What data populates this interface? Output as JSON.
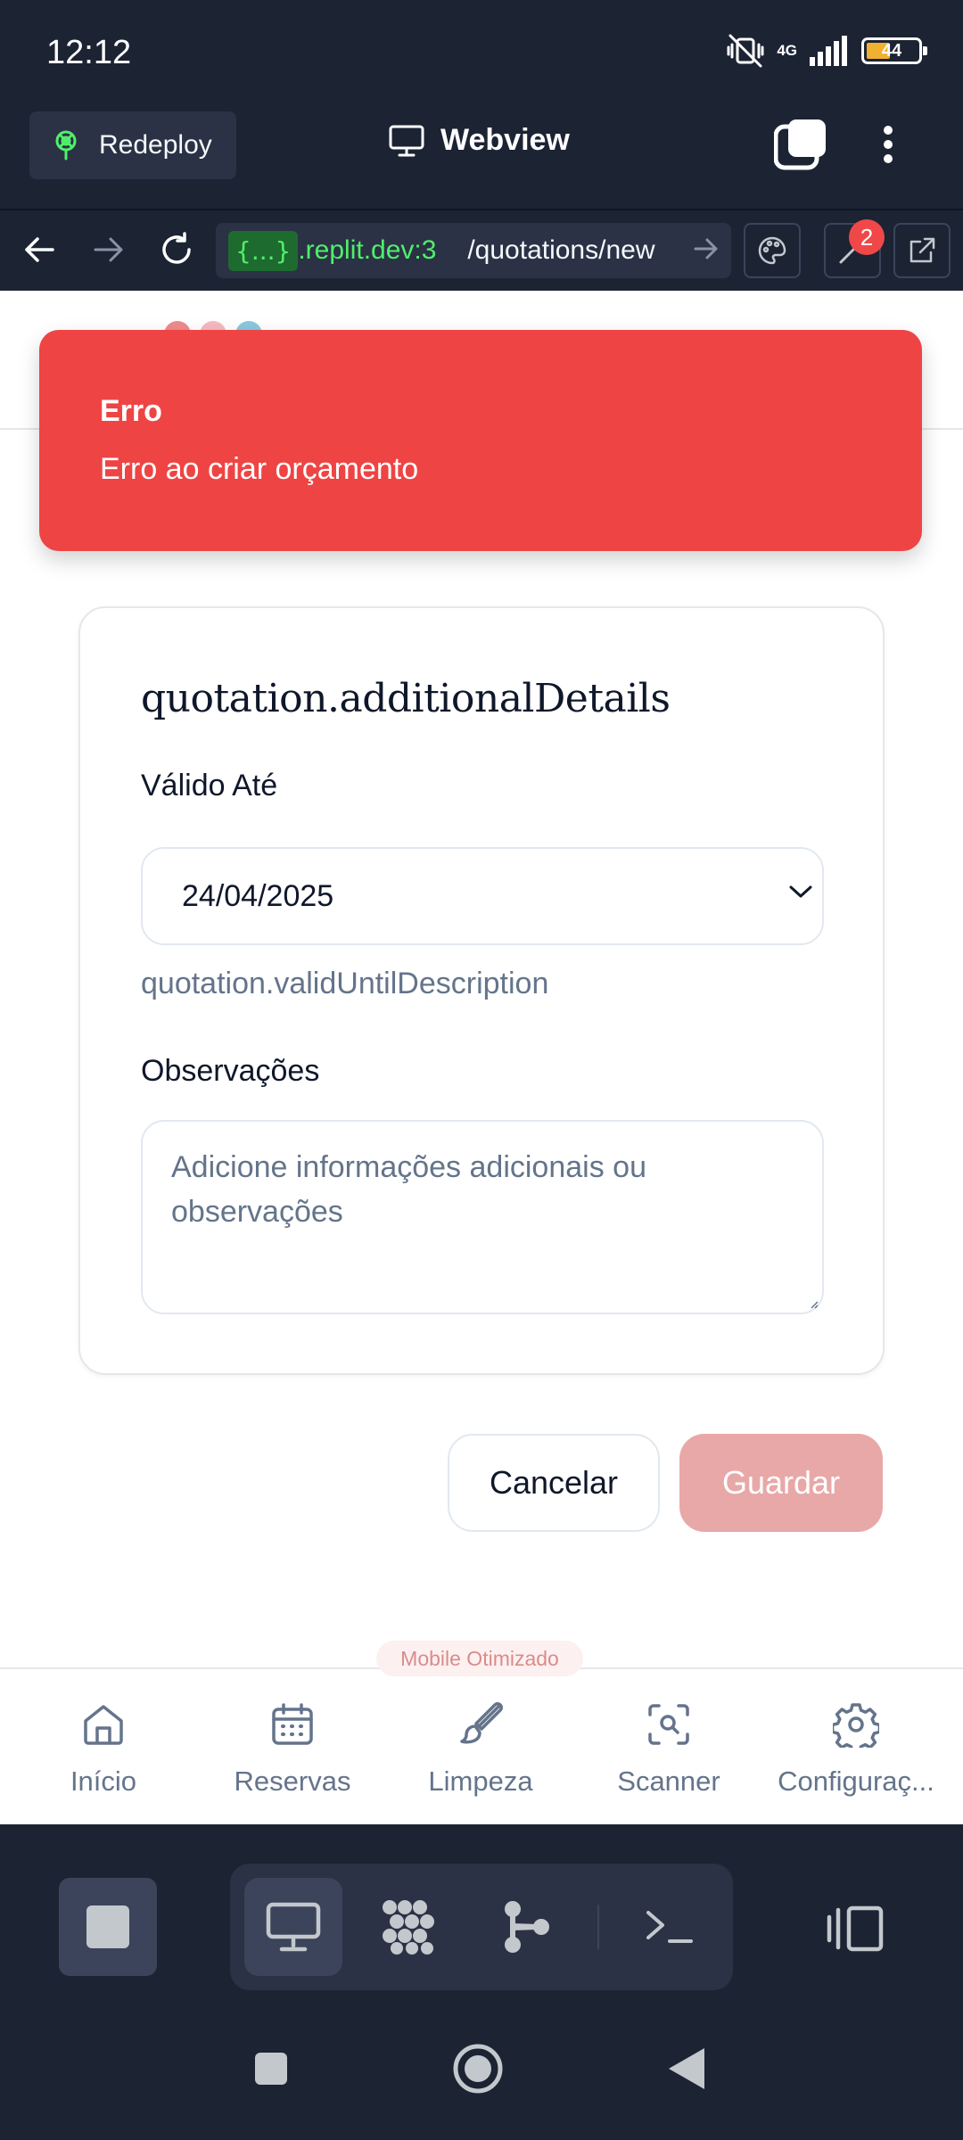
{
  "status_bar": {
    "time": "12:12",
    "network": "4G",
    "battery": "44"
  },
  "replit": {
    "redeploy_label": "Redeploy",
    "title": "Webview"
  },
  "url_bar": {
    "tag": "{...}",
    "host": ".replit.dev:3",
    "path": "/quotations/new",
    "tools_badge": "2"
  },
  "toast": {
    "title": "Erro",
    "message": "Erro ao criar orçamento"
  },
  "form": {
    "title": "quotation.additionalDetails",
    "valid_until_label": "Válido Até",
    "valid_until_value": "24/04/2025",
    "valid_until_help": "quotation.validUntilDescription",
    "notes_label": "Observações",
    "notes_placeholder": "Adicione informações adicionais ou observações"
  },
  "actions": {
    "cancel": "Cancelar",
    "save": "Guardar"
  },
  "mobile_badge": "Mobile Otimizado",
  "bottom_nav": {
    "items": [
      {
        "label": "Início",
        "icon": "home-icon"
      },
      {
        "label": "Reservas",
        "icon": "calendar-icon"
      },
      {
        "label": "Limpeza",
        "icon": "brush-icon"
      },
      {
        "label": "Scanner",
        "icon": "scan-icon"
      },
      {
        "label": "Configuraç...",
        "icon": "gear-icon"
      }
    ]
  },
  "colors": {
    "toast_bg": "#ef4444",
    "save_disabled": "#e8a8a8",
    "replit_bg": "#1c2333",
    "url_green": "#4ff06a"
  }
}
